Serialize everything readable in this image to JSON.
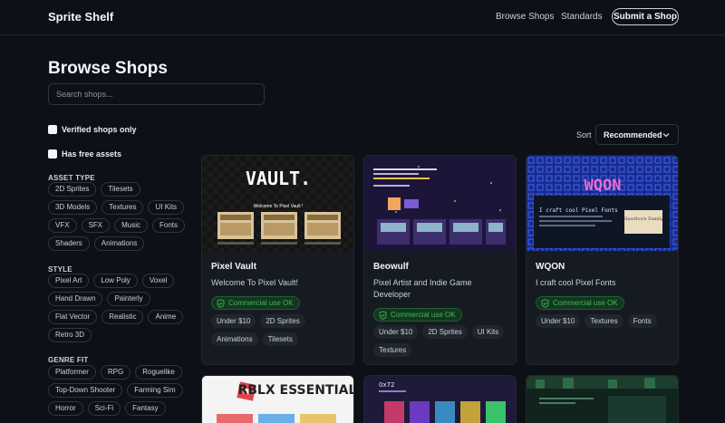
{
  "header": {
    "brand": "Sprite Shelf",
    "nav": {
      "browse": "Browse Shops",
      "standards": "Standards"
    },
    "submit_label": "Submit a Shop"
  },
  "main": {
    "title": "Browse Shops",
    "search_placeholder": "Search shops..."
  },
  "filters": {
    "verified_label": "Verified shops only",
    "free_label": "Has free assets",
    "asset_type": {
      "label": "ASSET TYPE",
      "options": [
        "2D Sprites",
        "Tilesets",
        "3D Models",
        "Textures",
        "UI Kits",
        "VFX",
        "SFX",
        "Music",
        "Fonts",
        "Shaders",
        "Animations"
      ]
    },
    "style": {
      "label": "STYLE",
      "options": [
        "Pixel Art",
        "Low Poly",
        "Voxel",
        "Hand Drawn",
        "Painterly",
        "Flat Vector",
        "Realistic",
        "Anime",
        "Retro 3D"
      ]
    },
    "genre_fit": {
      "label": "GENRE FIT",
      "options": [
        "Platformer",
        "RPG",
        "Roguelike",
        "Top-Down Shooter",
        "Farming Sim",
        "Horror",
        "Sci-Fi",
        "Fantasy"
      ]
    }
  },
  "sort": {
    "label": "Sort",
    "value": "Recommended"
  },
  "cards": [
    {
      "title": "Pixel Vault",
      "description": "Welcome To Pixel Vault!",
      "badge": "Commercial use OK",
      "tags": [
        "Under $10",
        "2D Sprites",
        "Animations",
        "Tilesets"
      ],
      "thumb_text": "VAULT.",
      "thumb_subtitle": "Welcome To Pixel Vault !"
    },
    {
      "title": "Beowulf",
      "description": "Pixel Artist and Indie Game Developer",
      "badge": "Commercial use OK",
      "tags": [
        "Under $10",
        "2D Sprites",
        "UI Kits",
        "Textures"
      ]
    },
    {
      "title": "WQON",
      "description": "I craft cool Pixel Fonts",
      "badge": "Commercial use OK",
      "tags": [
        "Under $10",
        "Textures",
        "Fonts"
      ],
      "thumb_text": "WQON",
      "thumb_subtitle": "I craft cool Pixel Fonts",
      "thumb_tag": "Hawthorn Family"
    }
  ],
  "bottom_cards": [
    {
      "thumb_text": "RBLX ESSENTIALS"
    },
    {
      "thumb_text": "0x72"
    },
    {
      "thumb_text": ""
    }
  ],
  "colors": {
    "background": "#0d1117",
    "card": "#161b22",
    "border": "#30363d",
    "success": "#3fb950",
    "badge_bg": "#143620"
  }
}
